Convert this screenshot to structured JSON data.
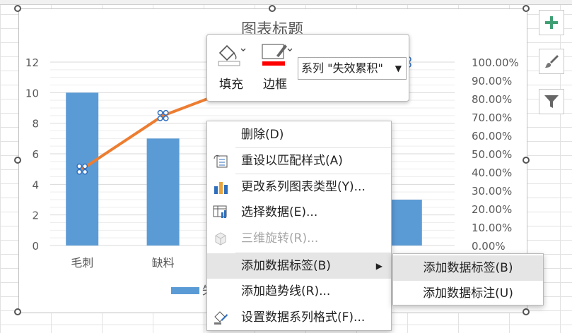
{
  "chart_data": {
    "type": "bar",
    "title": "图表标题",
    "categories": [
      "毛刺",
      "缺料",
      "",
      "",
      ""
    ],
    "visible_categories": [
      "毛刺",
      "缺料"
    ],
    "series": [
      {
        "name": "失",
        "type": "bar",
        "color": "#5b9bd5",
        "values": [
          10,
          7,
          null,
          null,
          3
        ]
      },
      {
        "name": "失效累积",
        "type": "line",
        "color": "#ed7d31",
        "values": [
          0.4167,
          0.7083,
          0.875,
          null,
          1.0
        ]
      }
    ],
    "y_left": {
      "min": 0,
      "max": 12,
      "ticks": [
        "0",
        "2",
        "4",
        "6",
        "8",
        "10",
        "12"
      ]
    },
    "y_right": {
      "min": 0,
      "max": 1,
      "ticks": [
        "0.00%",
        "10.00%",
        "20.00%",
        "30.00%",
        "40.00%",
        "50.00%",
        "60.00%",
        "70.00%",
        "80.00%",
        "90.00%",
        "100.00%"
      ]
    },
    "grid": true
  },
  "mini_toolbar": {
    "fill_label": "填充",
    "border_label": "边框",
    "series_select": "系列 \"失效累积\""
  },
  "context_menu": {
    "items": [
      {
        "label": "删除(D)",
        "icon": "none"
      },
      {
        "label": "重设以匹配样式(A)",
        "icon": "reset-style-icon"
      },
      {
        "label": "更改系列图表类型(Y)...",
        "icon": "bar-chart-icon"
      },
      {
        "label": "选择数据(E)...",
        "icon": "select-data-icon"
      },
      {
        "label": "三维旋转(R)...",
        "icon": "3d-rotation-icon",
        "disabled": true
      },
      {
        "label": "添加数据标签(B)",
        "icon": "none",
        "submenu": true
      },
      {
        "label": "添加趋势线(R)...",
        "icon": "none"
      },
      {
        "label": "设置数据系列格式(F)...",
        "icon": "format-series-icon"
      }
    ]
  },
  "submenu": {
    "items": [
      "添加数据标签(B)",
      "添加数据标注(U)"
    ]
  },
  "side_toolbar": [
    "chart-elements-icon",
    "chart-styles-icon",
    "chart-filters-icon"
  ],
  "colors": {
    "bar": "#5b9bd5",
    "line": "#ed7d31",
    "accent_green": "#217346"
  }
}
